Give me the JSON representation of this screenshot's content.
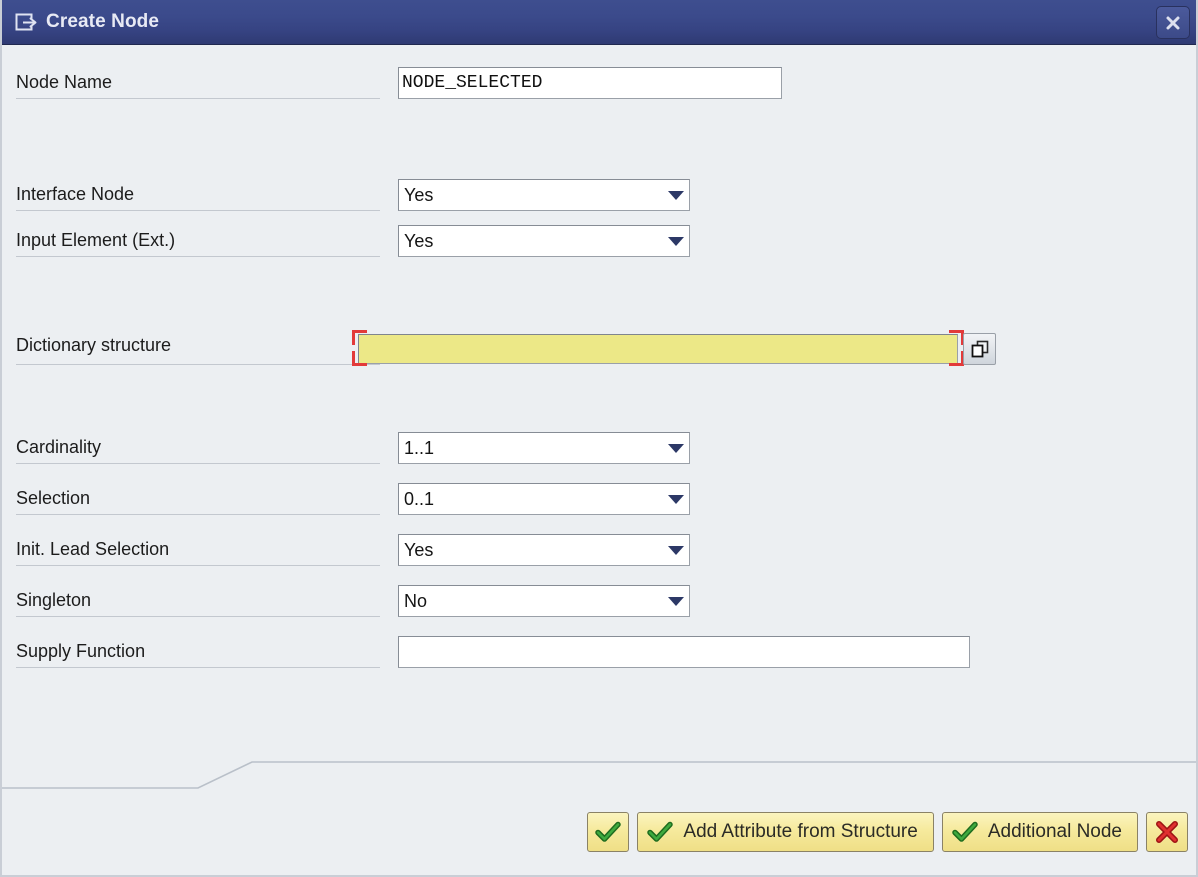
{
  "window": {
    "title": "Create Node",
    "title_icon": "create-node-icon",
    "close_icon": "close-icon",
    "accent_color": "#3b4a8b",
    "background_color": "#eceff2"
  },
  "form": {
    "fields": [
      {
        "name": "node-name",
        "label": "Node Name",
        "kind": "text",
        "value": "NODE_SELECTED",
        "placeholder": ""
      },
      {
        "name": "interface-node",
        "label": "Interface Node",
        "kind": "dropdown",
        "value": "Yes"
      },
      {
        "name": "input-element-ext",
        "label": "Input Element (Ext.)",
        "kind": "dropdown",
        "value": "Yes"
      },
      {
        "name": "dictionary-structure",
        "label": "Dictionary structure",
        "kind": "required-text",
        "value": "",
        "placeholder": "",
        "required_color": "#ece887",
        "focus_marker_color": "#e23a3a",
        "value_help_icon": "value-help-icon"
      },
      {
        "name": "cardinality",
        "label": "Cardinality",
        "kind": "dropdown",
        "value": "1..1"
      },
      {
        "name": "selection",
        "label": "Selection",
        "kind": "dropdown",
        "value": "0..1"
      },
      {
        "name": "init-lead-selection",
        "label": "Init. Lead Selection",
        "kind": "dropdown",
        "value": "Yes"
      },
      {
        "name": "singleton",
        "label": "Singleton",
        "kind": "dropdown",
        "value": "No"
      },
      {
        "name": "supply-function",
        "label": "Supply Function",
        "kind": "text",
        "value": "",
        "placeholder": ""
      }
    ]
  },
  "footer": {
    "buttons": [
      {
        "name": "confirm-button",
        "label": "",
        "icon": "green-check-icon"
      },
      {
        "name": "add-attribute-from-structure-button",
        "label": "Add Attribute from Structure",
        "icon": "green-check-icon"
      },
      {
        "name": "additional-node-button",
        "label": "Additional Node",
        "icon": "green-check-icon"
      },
      {
        "name": "cancel-button",
        "label": "",
        "icon": "red-cross-icon"
      }
    ]
  }
}
